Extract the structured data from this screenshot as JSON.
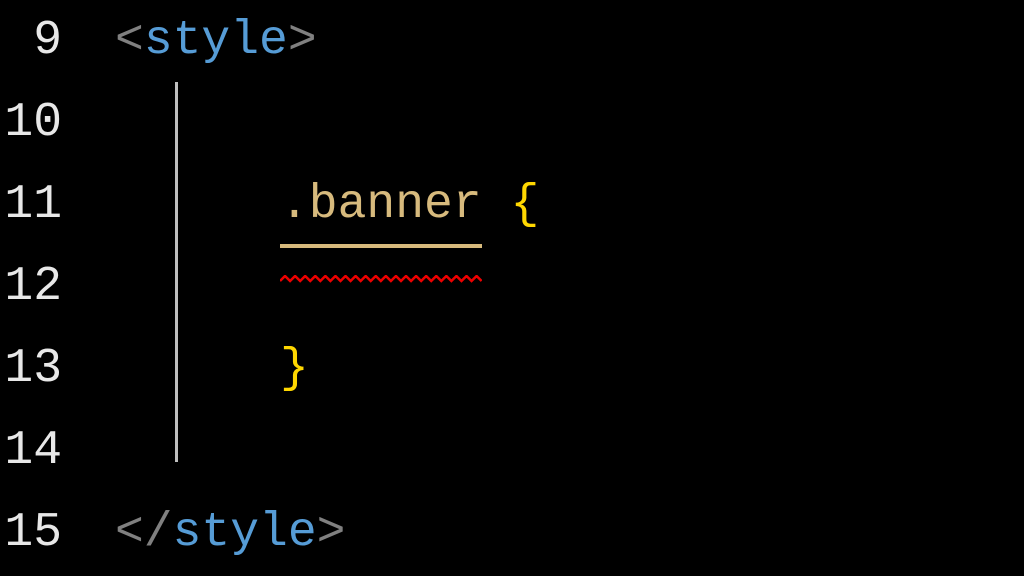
{
  "editor": {
    "lines": [
      {
        "number": "9",
        "indent": 1,
        "tokens": [
          {
            "text": "<",
            "class": "token-bracket"
          },
          {
            "text": "style",
            "class": "token-tag"
          },
          {
            "text": ">",
            "class": "token-bracket"
          }
        ]
      },
      {
        "number": "10",
        "indent": 0,
        "tokens": []
      },
      {
        "number": "11",
        "indent": 2,
        "tokens": [
          {
            "text": ".banner",
            "class": "token-selector",
            "underline": true
          },
          {
            "text": " ",
            "class": ""
          },
          {
            "text": "{",
            "class": "token-brace"
          }
        ]
      },
      {
        "number": "12",
        "indent": 0,
        "tokens": []
      },
      {
        "number": "13",
        "indent": 2,
        "tokens": [
          {
            "text": "}",
            "class": "token-brace"
          }
        ]
      },
      {
        "number": "14",
        "indent": 0,
        "tokens": []
      },
      {
        "number": "15",
        "indent": 1,
        "tokens": [
          {
            "text": "</",
            "class": "token-bracket"
          },
          {
            "text": "style",
            "class": "token-tag"
          },
          {
            "text": ">",
            "class": "token-bracket"
          }
        ]
      }
    ]
  },
  "colors": {
    "background": "#000000",
    "lineNumber": "#e8e8e8",
    "bracket": "#808080",
    "tag": "#569cd6",
    "selector": "#d7ba7d",
    "brace": "#ffd700",
    "zigzag": "#ff0000",
    "underline": "#d7ba7d"
  }
}
